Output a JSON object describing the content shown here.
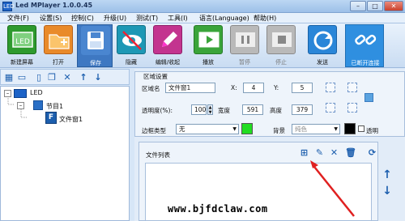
{
  "window": {
    "title": "Led MPlayer 1.0.0.45",
    "app_icon_text": "LED",
    "minimize": "–",
    "maximize": "□",
    "close": "✕"
  },
  "menu": [
    "文件(F)",
    "设置(S)",
    "控制(C)",
    "升级(U)",
    "测试(T)",
    "工具(I)",
    "语言(Language)",
    "帮助(H)"
  ],
  "toolbar": {
    "new": "新建屏幕",
    "open": "打开",
    "save": "保存",
    "hide": "隐藏",
    "edit": "编辑/收起",
    "play": "播放",
    "pause": "暂停",
    "stop": "停止",
    "send": "发送",
    "disconnect": "已断开连接"
  },
  "tree": {
    "root": "LED",
    "program": "节目1",
    "file_window": "文件窗1"
  },
  "area_settings": {
    "group_title": "区域设置",
    "name_label": "区域名",
    "name_value": "文件窗1",
    "x_label": "X:",
    "x_value": "4",
    "y_label": "Y:",
    "y_value": "5",
    "transparency_label": "透明度(%):",
    "transparency_value": "100",
    "width_label": "宽度",
    "width_value": "591",
    "height_label": "高度",
    "height_value": "379",
    "border_label": "边框类型",
    "border_value": "无",
    "bg_label": "背景",
    "bg_value": "纯色",
    "transparent_label": "透明"
  },
  "file_list": {
    "title": "文件列表"
  },
  "watermark": "www.bjfdclaw.com",
  "colors": {
    "border_color_swatch": "#22dd22",
    "bg_color_swatch": "#000000",
    "preview_square": "#5aa3e0",
    "arrow": "#e02020"
  }
}
